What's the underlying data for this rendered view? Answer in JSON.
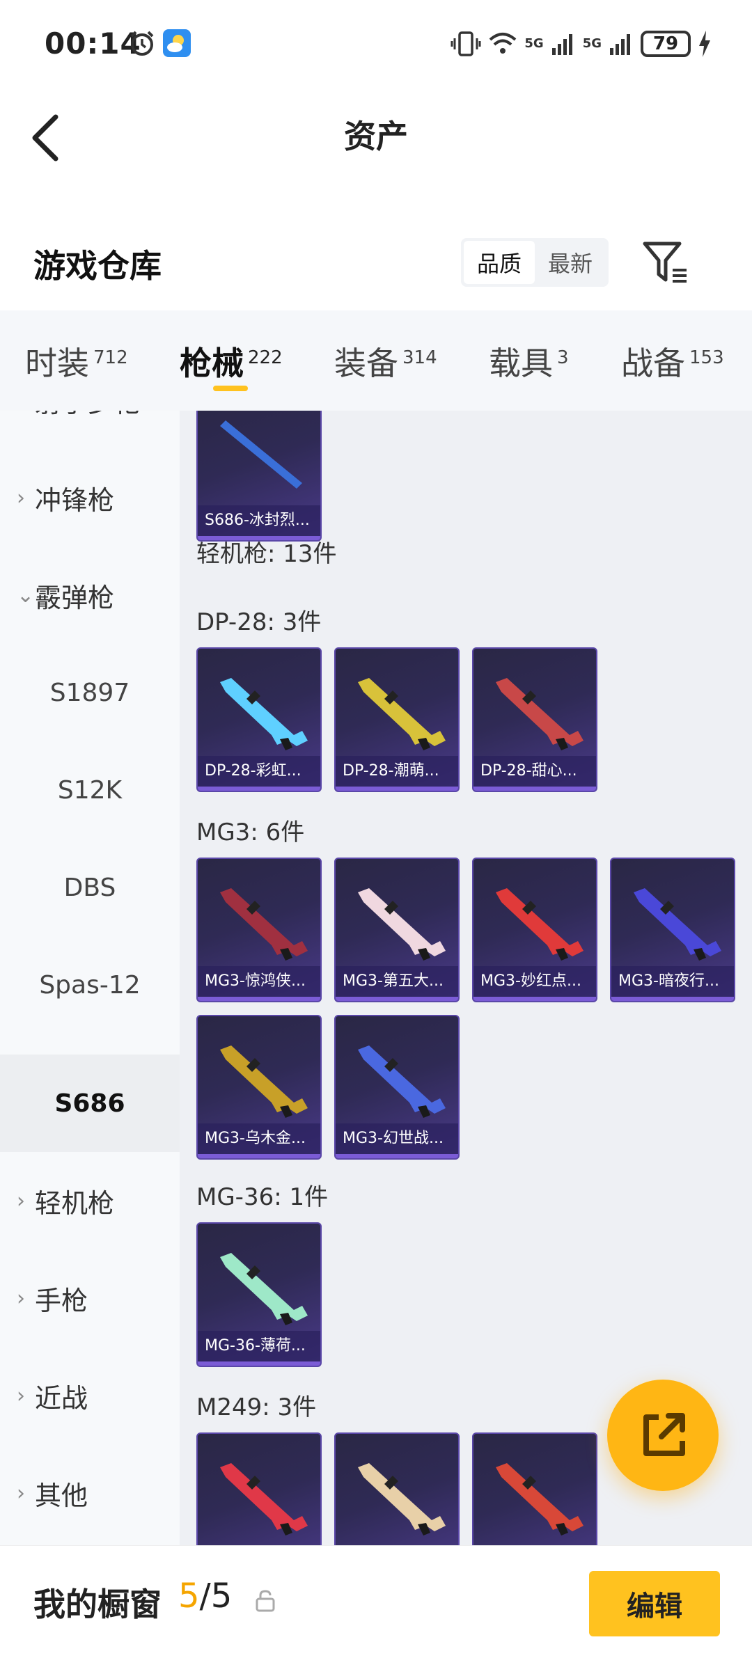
{
  "status_bar": {
    "time": "00:14",
    "battery": "79",
    "net1": "5G",
    "net2": "5G"
  },
  "header": {
    "title": "资产"
  },
  "warehouse": {
    "title": "游戏仓库",
    "sort_options": [
      "品质",
      "最新"
    ],
    "active_sort": "品质"
  },
  "tabs": [
    {
      "label": "时装",
      "count": "712"
    },
    {
      "label": "枪械",
      "count": "222"
    },
    {
      "label": "装备",
      "count": "314"
    },
    {
      "label": "载具",
      "count": "3"
    },
    {
      "label": "战备",
      "count": "153"
    }
  ],
  "active_tab": "枪械",
  "sidebar": {
    "items": [
      {
        "label": "射手步枪",
        "type": "group"
      },
      {
        "label": "冲锋枪",
        "type": "group"
      },
      {
        "label": "霰弹枪",
        "type": "group-open"
      },
      {
        "label": "S1897",
        "type": "sub"
      },
      {
        "label": "S12K",
        "type": "sub"
      },
      {
        "label": "DBS",
        "type": "sub"
      },
      {
        "label": "Spas-12",
        "type": "sub"
      },
      {
        "label": "S686",
        "type": "sub-selected"
      },
      {
        "label": "轻机枪",
        "type": "group"
      },
      {
        "label": "手枪",
        "type": "group"
      },
      {
        "label": "近战",
        "type": "group"
      },
      {
        "label": "其他",
        "type": "group"
      }
    ]
  },
  "content": {
    "top_card": {
      "name": "S686-冰封烈...",
      "color": "#3a6fd8"
    },
    "category_title": "轻机枪: 13件",
    "sections": [
      {
        "title": "DP-28: 3件",
        "items": [
          {
            "name": "DP-28-彩虹...",
            "color": "#5fd0ff"
          },
          {
            "name": "DP-28-潮萌...",
            "color": "#d8c23a"
          },
          {
            "name": "DP-28-甜心...",
            "color": "#c84848"
          }
        ]
      },
      {
        "title": "MG3: 6件",
        "items": [
          {
            "name": "MG3-惊鸿侠...",
            "color": "#a03040"
          },
          {
            "name": "MG3-第五大...",
            "color": "#f0d8e0"
          },
          {
            "name": "MG3-妙红点...",
            "color": "#e03a3a"
          },
          {
            "name": "MG3-暗夜行...",
            "color": "#4a48d8"
          },
          {
            "name": "MG3-乌木金...",
            "color": "#c8a028"
          },
          {
            "name": "MG3-幻世战...",
            "color": "#4a68e0"
          }
        ]
      },
      {
        "title": "MG-36: 1件",
        "items": [
          {
            "name": "MG-36-薄荷...",
            "color": "#9ee8c8"
          }
        ]
      },
      {
        "title": "M249: 3件",
        "items": [
          {
            "name": "",
            "color": "#e03848"
          },
          {
            "name": "",
            "color": "#e8d0a8"
          },
          {
            "name": "",
            "color": "#d84838"
          }
        ]
      }
    ]
  },
  "bottom_bar": {
    "label": "我的橱窗",
    "current": "5",
    "total": "/5",
    "edit_label": "编辑"
  },
  "colors": {
    "accent": "#ffc21f",
    "fab": "#ffb614"
  }
}
